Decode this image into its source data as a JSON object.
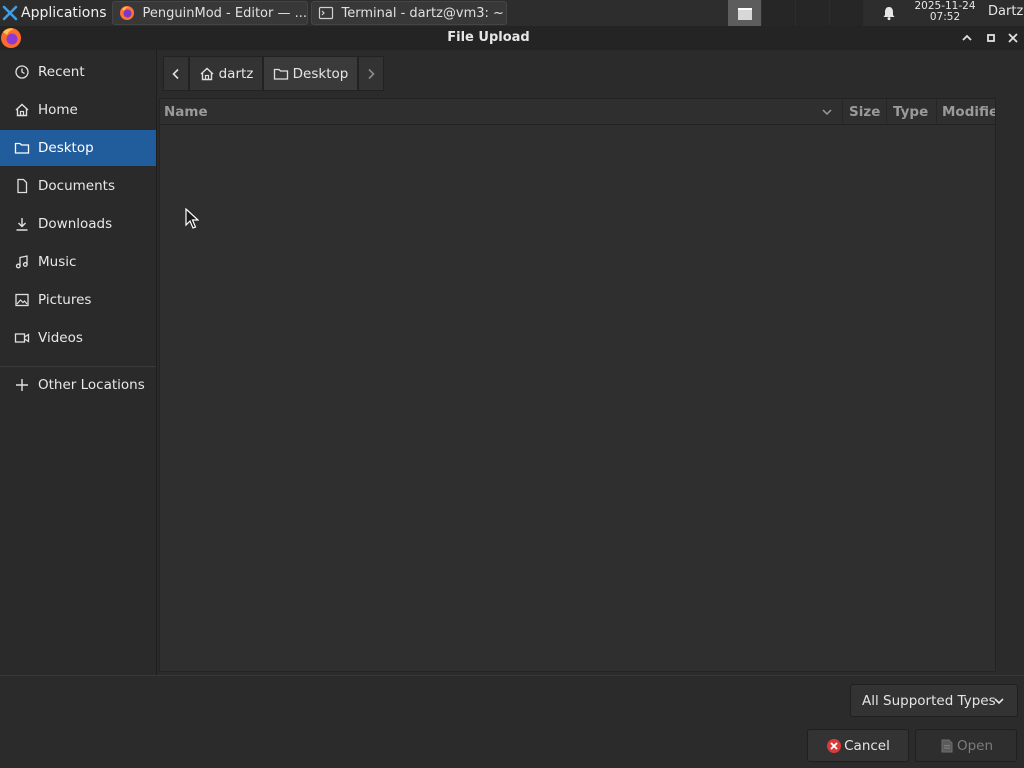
{
  "taskbar": {
    "apps_label": "Applications",
    "tasks": [
      {
        "label": "PenguinMod - Editor — ...",
        "icon": "firefox-icon"
      },
      {
        "label": "Terminal - dartz@vm3: ~",
        "icon": "terminal-icon"
      }
    ],
    "clock_date": "2025-11-24",
    "clock_time": "07:52",
    "user": "Dartz",
    "workspaces": 4,
    "active_workspace": 1
  },
  "dialog": {
    "title": "File Upload"
  },
  "sidebar": {
    "items": [
      {
        "label": "Recent",
        "icon": "clock-icon",
        "selected": false
      },
      {
        "label": "Home",
        "icon": "home-icon",
        "selected": false
      },
      {
        "label": "Desktop",
        "icon": "folder-icon",
        "selected": true
      },
      {
        "label": "Documents",
        "icon": "document-icon",
        "selected": false
      },
      {
        "label": "Downloads",
        "icon": "download-icon",
        "selected": false
      },
      {
        "label": "Music",
        "icon": "music-icon",
        "selected": false
      },
      {
        "label": "Pictures",
        "icon": "picture-icon",
        "selected": false
      },
      {
        "label": "Videos",
        "icon": "video-icon",
        "selected": false
      }
    ],
    "other_locations": "Other Locations"
  },
  "pathbar": {
    "crumbs": [
      {
        "label": "dartz",
        "icon": "home-icon"
      },
      {
        "label": "Desktop",
        "icon": "folder-icon"
      }
    ]
  },
  "filelist": {
    "columns": [
      "Name",
      "Size",
      "Type",
      "Modifie"
    ],
    "rows": []
  },
  "footer": {
    "filter_label": "All Supported Types",
    "cancel_label": "Cancel",
    "open_label": "Open"
  },
  "colors": {
    "selection": "#215d9c",
    "background": "#2b2b2b",
    "cancel_icon": "#d83b3b"
  }
}
